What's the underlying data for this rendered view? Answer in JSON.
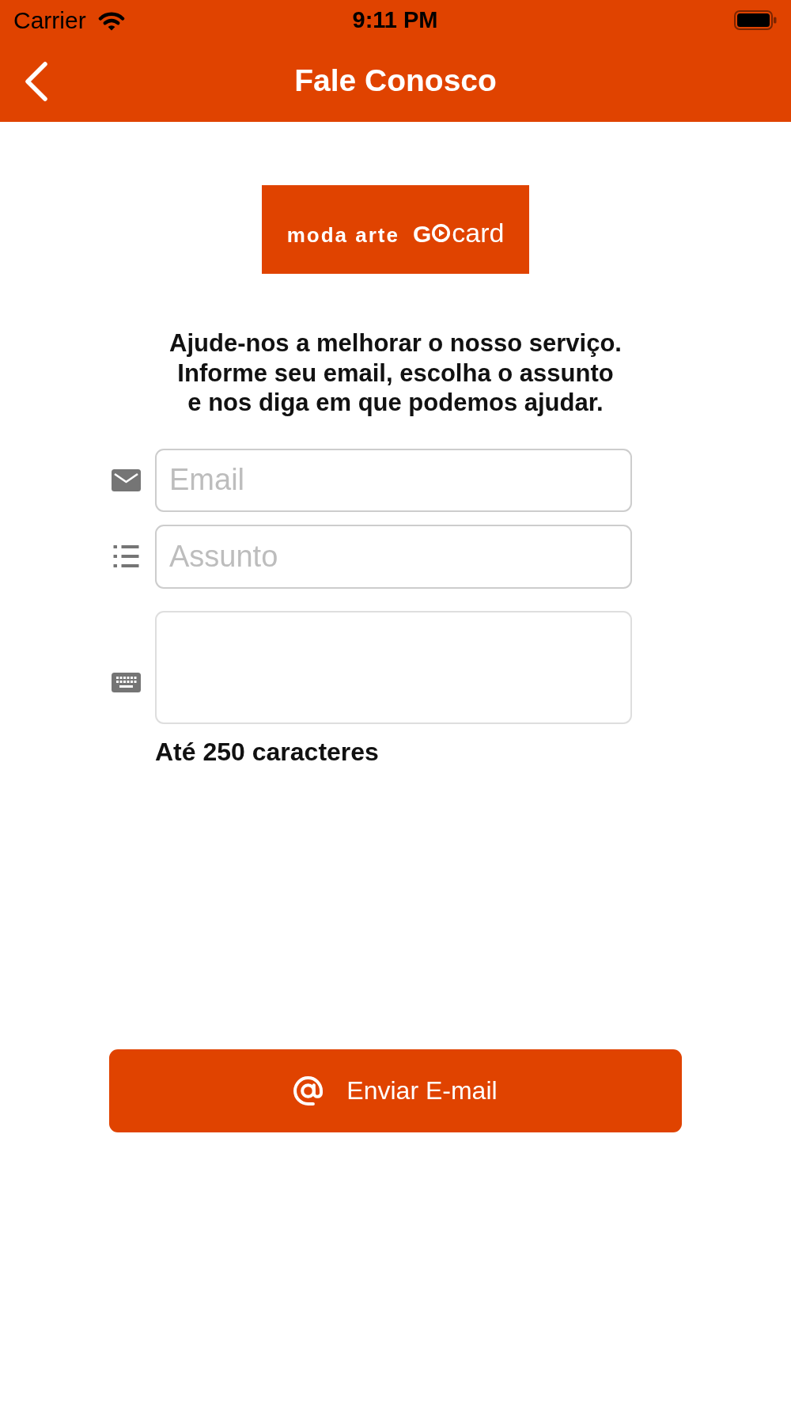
{
  "status_bar": {
    "carrier": "Carrier",
    "time": "9:11 PM"
  },
  "nav_bar": {
    "title": "Fale Conosco"
  },
  "logo": {
    "brand": "moda arte",
    "product_prefix": "G",
    "product_suffix": "card"
  },
  "intro": "Ajude-nos a melhorar o nosso serviço.\nInforme seu email, escolha o assunto\ne nos diga em que podemos ajudar.",
  "fields": [
    {
      "kind": "email",
      "placeholder": "Email"
    },
    {
      "kind": "subject",
      "placeholder": "Assunto"
    },
    {
      "kind": "message"
    }
  ],
  "char_limit_note": "Até 250 caracteres",
  "submit_button": {
    "label": "Enviar E-mail"
  }
}
